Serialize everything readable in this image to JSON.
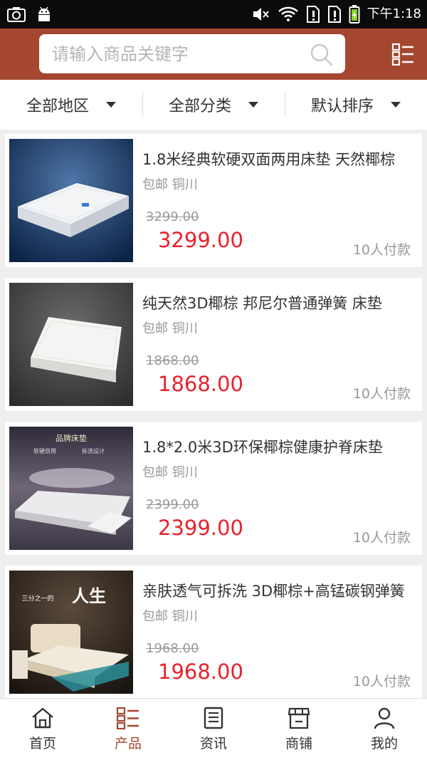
{
  "status_bar": {
    "time": "下午1:18"
  },
  "search": {
    "placeholder": "请输入商品关键字"
  },
  "filters": [
    {
      "label": "全部地区"
    },
    {
      "label": "全部分类"
    },
    {
      "label": "默认排序"
    }
  ],
  "products": [
    {
      "title": "1.8米经典软硬双面两用床垫 天然椰棕",
      "meta": "包邮 铜川",
      "original_price": "3299.00",
      "price": "3299.00",
      "paid": "10人付款"
    },
    {
      "title": "纯天然3D椰棕 邦尼尔普通弹簧 床垫",
      "meta": "包邮 铜川",
      "original_price": "1868.00",
      "price": "1868.00",
      "paid": "10人付款"
    },
    {
      "title": "1.8*2.0米3D环保椰棕健康护脊床垫",
      "meta": "包邮 铜川",
      "original_price": "2399.00",
      "price": "2399.00",
      "paid": "10人付款"
    },
    {
      "title": "亲肤透气可拆洗 3D椰棕+高锰碳钢弹簧",
      "meta": "包邮 铜川",
      "original_price": "1968.00",
      "price": "1968.00",
      "paid": "10人付款"
    }
  ],
  "product_images": [
    {
      "text": ""
    },
    {
      "text": ""
    },
    {
      "text": "品牌床垫",
      "sub1": "软硬双用",
      "sub2": "拆洗设计"
    },
    {
      "text": "人生",
      "sub1": "三分之一的"
    }
  ],
  "nav": [
    {
      "label": "首页",
      "icon": "home-icon"
    },
    {
      "label": "产品",
      "icon": "product-icon"
    },
    {
      "label": "资讯",
      "icon": "news-icon"
    },
    {
      "label": "商铺",
      "icon": "store-icon"
    },
    {
      "label": "我的",
      "icon": "user-icon"
    }
  ],
  "colors": {
    "brand": "#a5472f",
    "price": "#e8232d",
    "muted": "#999999"
  }
}
